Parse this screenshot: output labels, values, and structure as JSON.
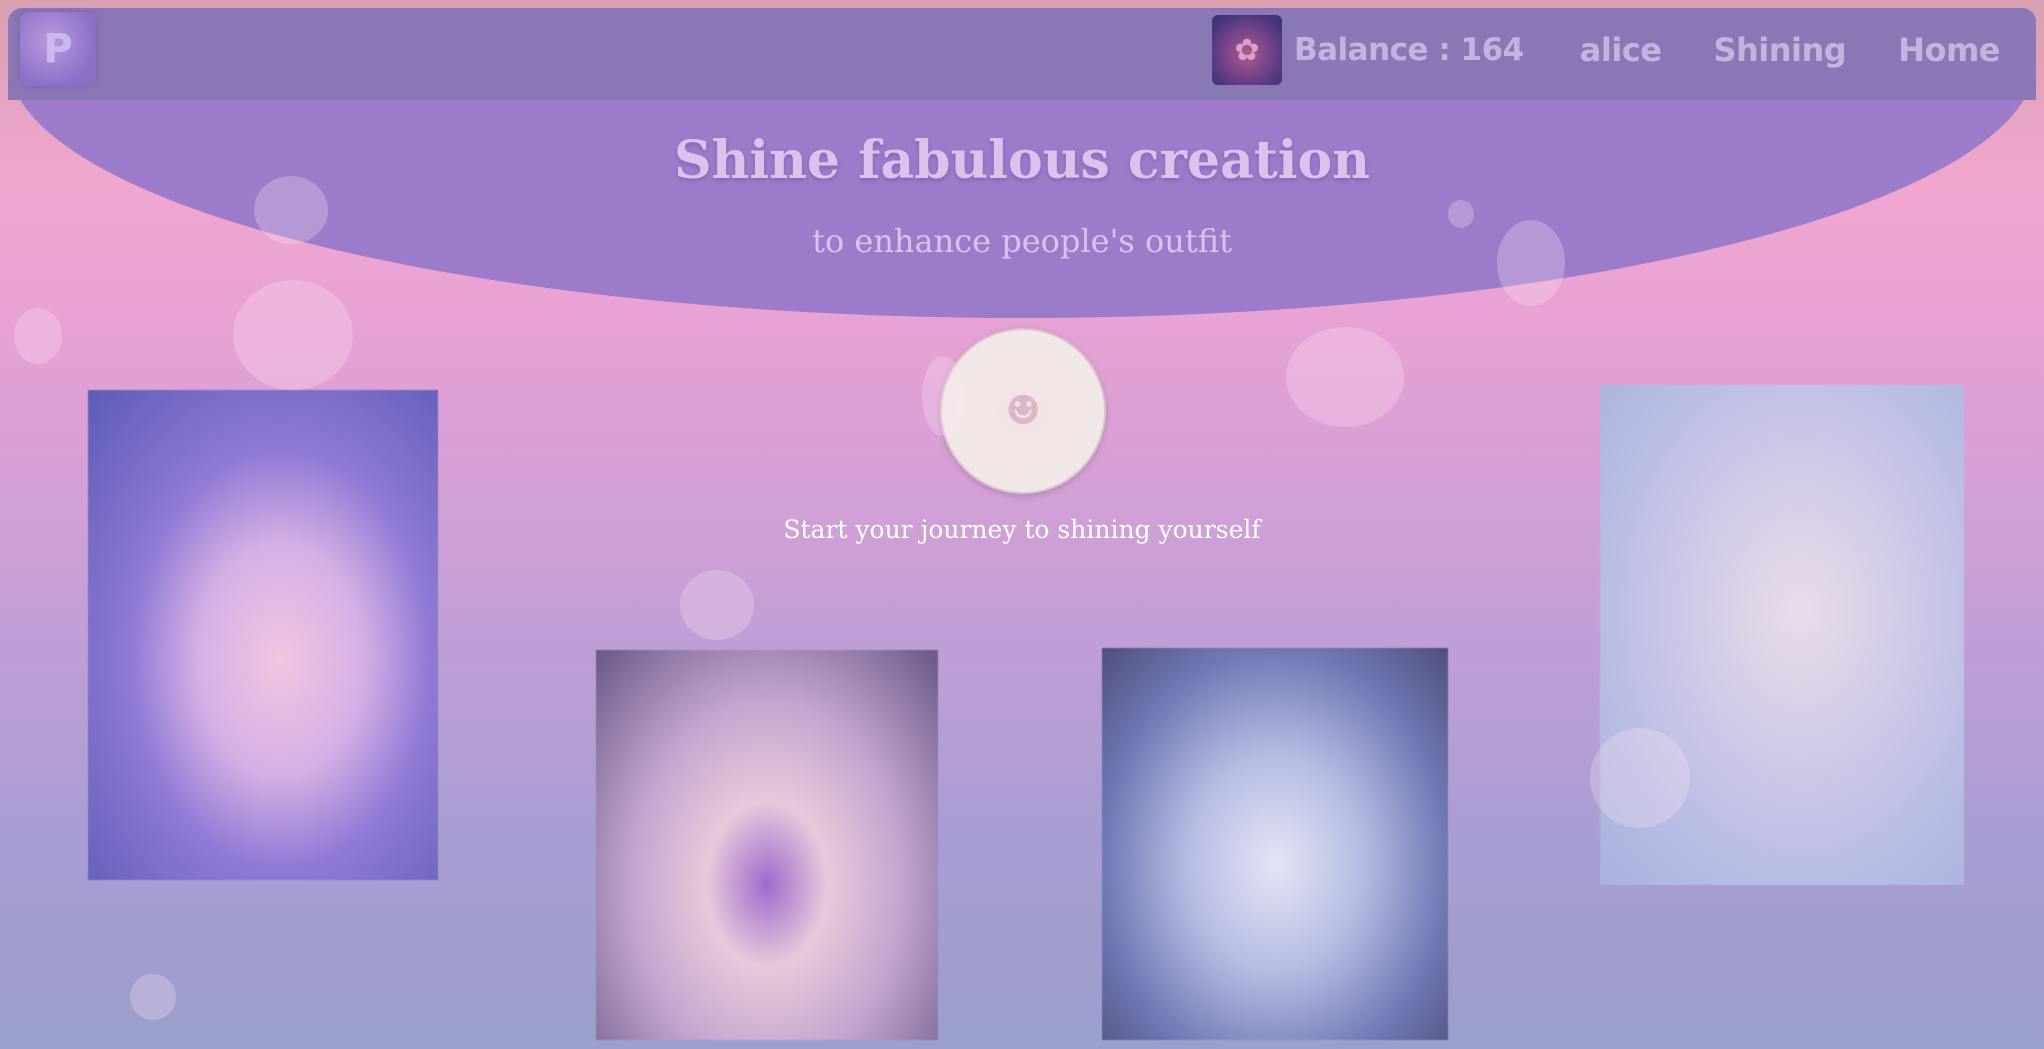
{
  "header": {
    "logo_text": "P",
    "avatar_icon": "tree-avatar-icon",
    "balance_label": "Balance : 164",
    "username": "alice",
    "nav": {
      "shining": "Shining",
      "home": "Home"
    }
  },
  "hero": {
    "title": "Shine fabulous creation",
    "subtitle": "to enhance people's outfit"
  },
  "cta": {
    "button_icon": "person-icon",
    "text": "Start your journey to shining yourself"
  },
  "gallery": {
    "items": [
      {
        "icon": "galaxy-dress-girl-image"
      },
      {
        "icon": "butterfly-face-image"
      },
      {
        "icon": "flower-crown-woman-image"
      },
      {
        "icon": "falling-boy-image"
      }
    ]
  },
  "colors": {
    "header_bg": "#8a77b5",
    "hero_bg": "#9c7bcb",
    "page_top": "#f0a6cf",
    "page_bottom": "#9a9fcc",
    "nav_text": "#c4b3df"
  }
}
